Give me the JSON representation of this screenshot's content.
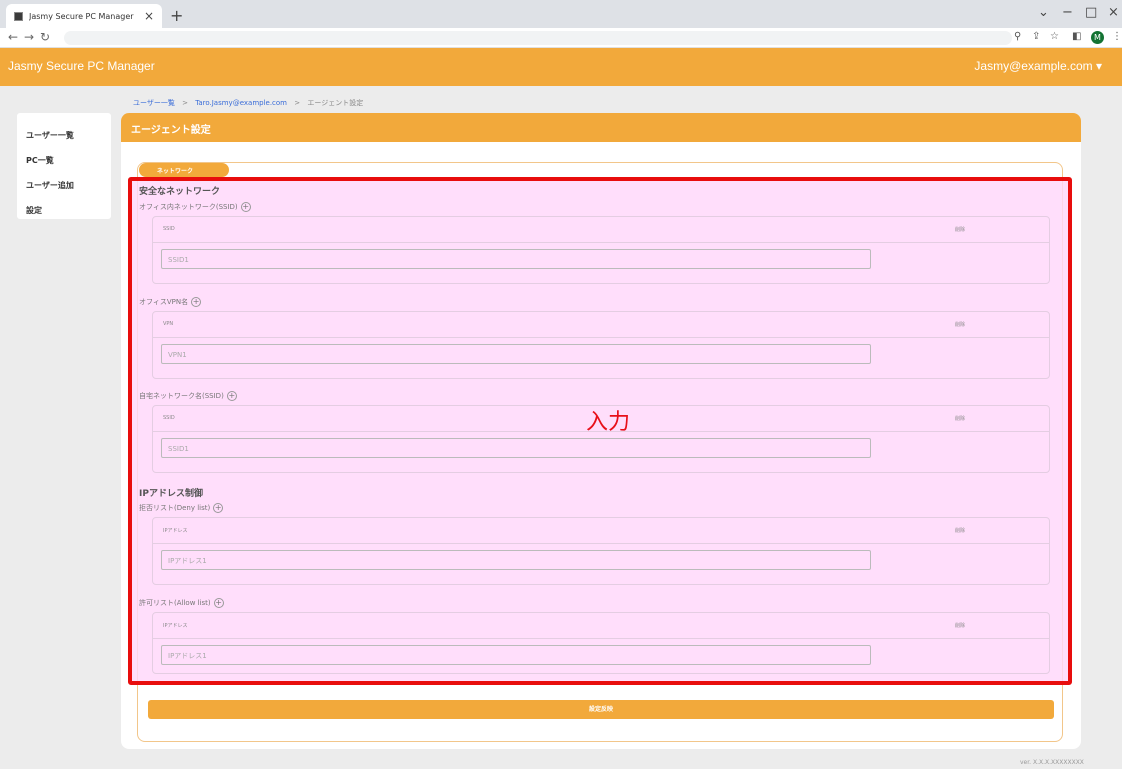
{
  "browser": {
    "tab_title": "Jasmy Secure PC Manager",
    "tab_close": "×",
    "new_tab": "+",
    "win_collapse": "⌄",
    "win_minimize": "−",
    "win_maximize": "□",
    "win_close": "×",
    "avatar_initial": "M"
  },
  "header": {
    "app_title": "Jasmy Secure PC Manager",
    "account": "Jasmy@example.com ▾"
  },
  "breadcrumb": {
    "items": [
      "ユーザー一覧",
      "Taro.Jasmy@example.com",
      "エージェント設定"
    ],
    "separator": ">"
  },
  "sidebar": {
    "items": [
      {
        "label": "ユーザー一覧"
      },
      {
        "label": "PC一覧"
      },
      {
        "label": "ユーザー追加"
      },
      {
        "label": "設定"
      }
    ]
  },
  "page": {
    "title": "エージェント設定",
    "section_tab": "ネットワーク",
    "overlay_label": "入力",
    "submit_label": "設定反映",
    "footer": "ver. X.X.X.XXXXXXXX"
  },
  "network": {
    "safe_network_heading": "安全なネットワーク",
    "office_ssid": {
      "label": "オフィス内ネットワーク(SSID)",
      "col_name": "SSID",
      "col_delete": "削除",
      "placeholder": "SSID1"
    },
    "office_vpn": {
      "label": "オフィスVPN名",
      "col_name": "VPN",
      "col_delete": "削除",
      "placeholder": "VPN1"
    },
    "home_ssid": {
      "label": "自宅ネットワーク名(SSID)",
      "col_name": "SSID",
      "col_delete": "削除",
      "placeholder": "SSID1"
    },
    "ip_control_heading": "IPアドレス制御",
    "deny_list": {
      "label": "拒否リスト(Deny list)",
      "col_name": "IPアドレス",
      "col_delete": "削除",
      "placeholder": "IPアドレス1"
    },
    "allow_list": {
      "label": "許可リスト(Allow list)",
      "col_name": "IPアドレス",
      "col_delete": "削除",
      "placeholder": "IPアドレス1"
    }
  },
  "colors": {
    "accent": "#f2a93b",
    "highlight_border": "#e80d0d",
    "highlight_fill": "#ffd7fa"
  }
}
